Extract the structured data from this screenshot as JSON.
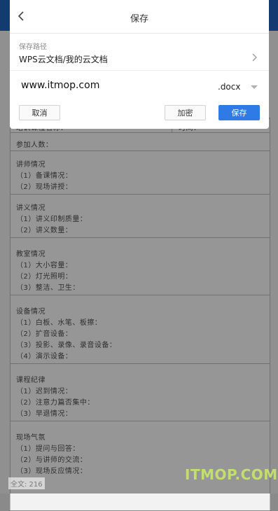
{
  "dialog": {
    "title": "保存",
    "path_label": "保存路径",
    "path_value": "WPS云文档/我的云文档",
    "filename": "www.itmop.com",
    "extension": ".docx",
    "buttons": {
      "cancel": "取消",
      "encrypt": "加密",
      "save": "保存"
    },
    "accent_color": "#2f7be6"
  },
  "document": {
    "header_row": {
      "left": "培训课程名称：",
      "right": "时间："
    },
    "attendees": "参加人数：",
    "sections": [
      {
        "title": "讲师情况",
        "items": [
          "（1）备课情况：",
          "（2）现场讲授："
        ]
      },
      {
        "title": "讲义情况",
        "items": [
          "（1）讲义印制质量：",
          "（2）讲义数量："
        ]
      },
      {
        "title": "教室情况",
        "items": [
          "（1）大小容量：",
          "（2）灯光照明：",
          "（3）整洁、卫生："
        ]
      },
      {
        "title": "设备情况",
        "items": [
          "（1）白板、水笔、板擦：",
          "（2）扩音设备：",
          "（3）投影、录像、录音设备：",
          "（4）演示设备："
        ]
      },
      {
        "title": "课程纪律",
        "items": [
          "（1）迟到情况：",
          "（2）注意力篇否集中：",
          "（3）早退情况："
        ]
      },
      {
        "title": "现场气氛",
        "items": [
          "（1）提问与回答：",
          "（2）与讲师的交流：",
          "（3）现场反应情况："
        ]
      }
    ],
    "word_count": "全文: 216"
  },
  "watermark": "ITMOP.COM"
}
